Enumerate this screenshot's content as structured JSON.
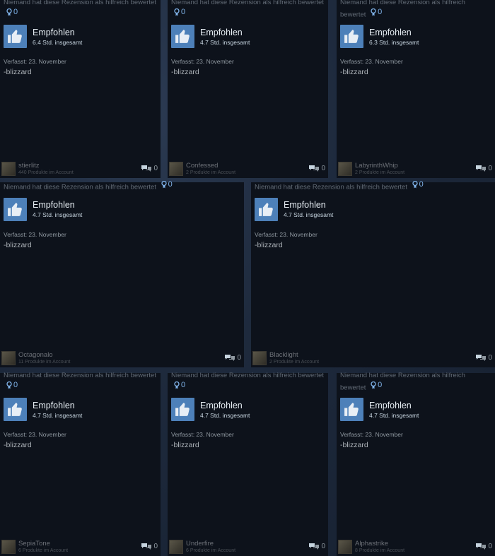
{
  "cards": [
    {
      "helpful_text": "Niemand hat diese Rezension als hilfreich bewertet",
      "award_count": "0",
      "recommendation": "Empfohlen",
      "hours": "6.4 Std. insgesamt",
      "posted": "Verfasst: 23. November",
      "text": "-blizzard",
      "author": "stierlitz",
      "products": "440 Produkte im Account",
      "comments": "0"
    },
    {
      "helpful_text": "Niemand hat diese Rezension als hilfreich bewertet",
      "award_count": "0",
      "recommendation": "Empfohlen",
      "hours": "4.7 Std. insgesamt",
      "posted": "Verfasst: 23. November",
      "text": "-blizzard",
      "author": "Confessed",
      "products": "2 Produkte im Account",
      "comments": "0"
    },
    {
      "helpful_text": "Niemand hat diese Rezension als hilfreich bewertet",
      "award_count": "0",
      "recommendation": "Empfohlen",
      "hours": "6.3 Std. insgesamt",
      "posted": "Verfasst: 23. November",
      "text": "-blizzard",
      "author": "LabyrinthWhip",
      "products": "2 Produkte im Account",
      "comments": "0"
    },
    {
      "helpful_text": "Niemand hat diese Rezension als hilfreich bewertet",
      "award_count": "0",
      "recommendation": "Empfohlen",
      "hours": "4.7 Std. insgesamt",
      "posted": "Verfasst: 23. November",
      "text": "-blizzard",
      "author": "Octagonalo",
      "products": "11 Produkte im Account",
      "comments": "0"
    },
    {
      "helpful_text": "Niemand hat diese Rezension als hilfreich bewertet",
      "award_count": "0",
      "recommendation": "Empfohlen",
      "hours": "4.7 Std. insgesamt",
      "posted": "Verfasst: 23. November",
      "text": "-blizzard",
      "author": "Blacklight",
      "products": "2 Produkte im Account",
      "comments": "0"
    },
    {
      "helpful_text": "Niemand hat diese Rezension als hilfreich bewertet",
      "award_count": "0",
      "recommendation": "Empfohlen",
      "hours": "4.7 Std. insgesamt",
      "posted": "Verfasst: 23. November",
      "text": "-blizzard",
      "author": "SepiaTone",
      "products": "6 Produkte im Account",
      "comments": "0"
    },
    {
      "helpful_text": "Niemand hat diese Rezension als hilfreich bewertet",
      "award_count": "0",
      "recommendation": "Empfohlen",
      "hours": "4.7 Std. insgesamt",
      "posted": "Verfasst: 23. November",
      "text": "-blizzard",
      "author": "Underfire",
      "products": "6 Produkte im Account",
      "comments": "0"
    },
    {
      "helpful_text": "Niemand hat diese Rezension als hilfreich bewertet",
      "award_count": "0",
      "recommendation": "Empfohlen",
      "hours": "4.7 Std. insgesamt",
      "posted": "Verfasst: 23. November",
      "text": "-blizzard",
      "author": "Alphastrike",
      "products": "8 Produkte im Account",
      "comments": "0"
    }
  ],
  "colors": {
    "thumb_bg": "#4d80b9",
    "card_bg": "#0d121b",
    "award_blue": "#7fb2e8"
  },
  "icons": {
    "recommend": "thumbs-up-icon",
    "award": "award-icon",
    "comments": "comment-bubble-icon"
  }
}
